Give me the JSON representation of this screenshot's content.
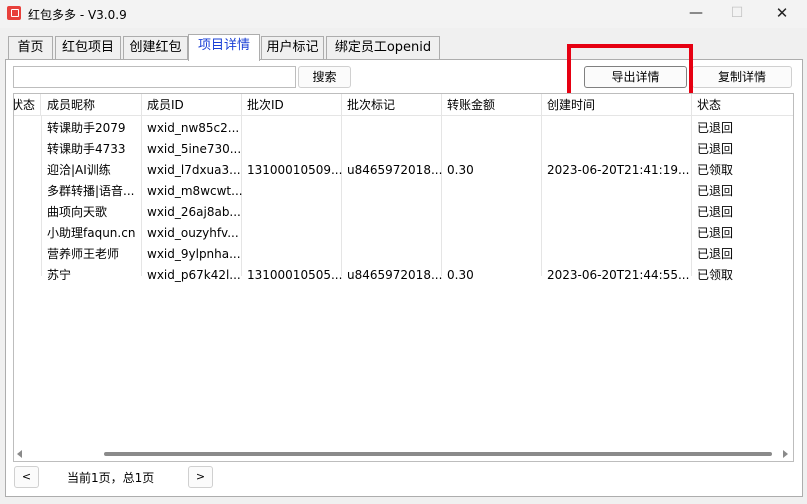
{
  "window": {
    "title": "红包多多 - V3.0.9",
    "controls": {
      "minimize": "—",
      "maximize": "☐",
      "close": "✕"
    }
  },
  "tabs": [
    {
      "label": "首页",
      "active": false
    },
    {
      "label": "红包项目",
      "active": false
    },
    {
      "label": "创建红包",
      "active": false
    },
    {
      "label": "项目详情",
      "active": true
    },
    {
      "label": "用户标记",
      "active": false
    },
    {
      "label": "绑定员工openid",
      "active": false
    }
  ],
  "toolbar": {
    "search_placeholder": "",
    "search_value": "",
    "search_label": "搜索",
    "export_label": "导出详情",
    "copy_label": "复制详情"
  },
  "colors": {
    "active_tab_text": "#1a3fd6",
    "highlight_box": "#e60012"
  },
  "table": {
    "columns": [
      "状态",
      "成员昵称",
      "成员ID",
      "批次ID",
      "批次标记",
      "转账金额",
      "创建时间",
      "状态"
    ],
    "rows": [
      [
        "",
        "转课助手2079",
        "wxid_nw85c2...",
        "",
        "",
        "",
        "",
        "已退回"
      ],
      [
        "",
        "转课助手4733",
        "wxid_5ine730...",
        "",
        "",
        "",
        "",
        "已退回"
      ],
      [
        "",
        "迎洽|AI训练",
        "wxid_l7dxua3...",
        "13100010509...",
        "u8465972018...",
        "0.30",
        "2023-06-20T21:41:19...",
        "已领取"
      ],
      [
        "",
        "多群转播|语音...",
        "wxid_m8wcwt...",
        "",
        "",
        "",
        "",
        "已退回"
      ],
      [
        "",
        "曲项向天歌",
        "wxid_26aj8ab...",
        "",
        "",
        "",
        "",
        "已退回"
      ],
      [
        "",
        "小助理faqun.cn",
        "wxid_ouzyhfv...",
        "",
        "",
        "",
        "",
        "已退回"
      ],
      [
        "",
        "营养师王老师",
        "wxid_9ylpnha...",
        "",
        "",
        "",
        "",
        "已退回"
      ],
      [
        "",
        "苏宁",
        "wxid_p67k42l...",
        "13100010505...",
        "u8465972018...",
        "0.30",
        "2023-06-20T21:44:55...",
        "已领取"
      ]
    ]
  },
  "pager": {
    "prev_label": "<",
    "next_label": ">",
    "status_text": "当前1页，总1页"
  }
}
